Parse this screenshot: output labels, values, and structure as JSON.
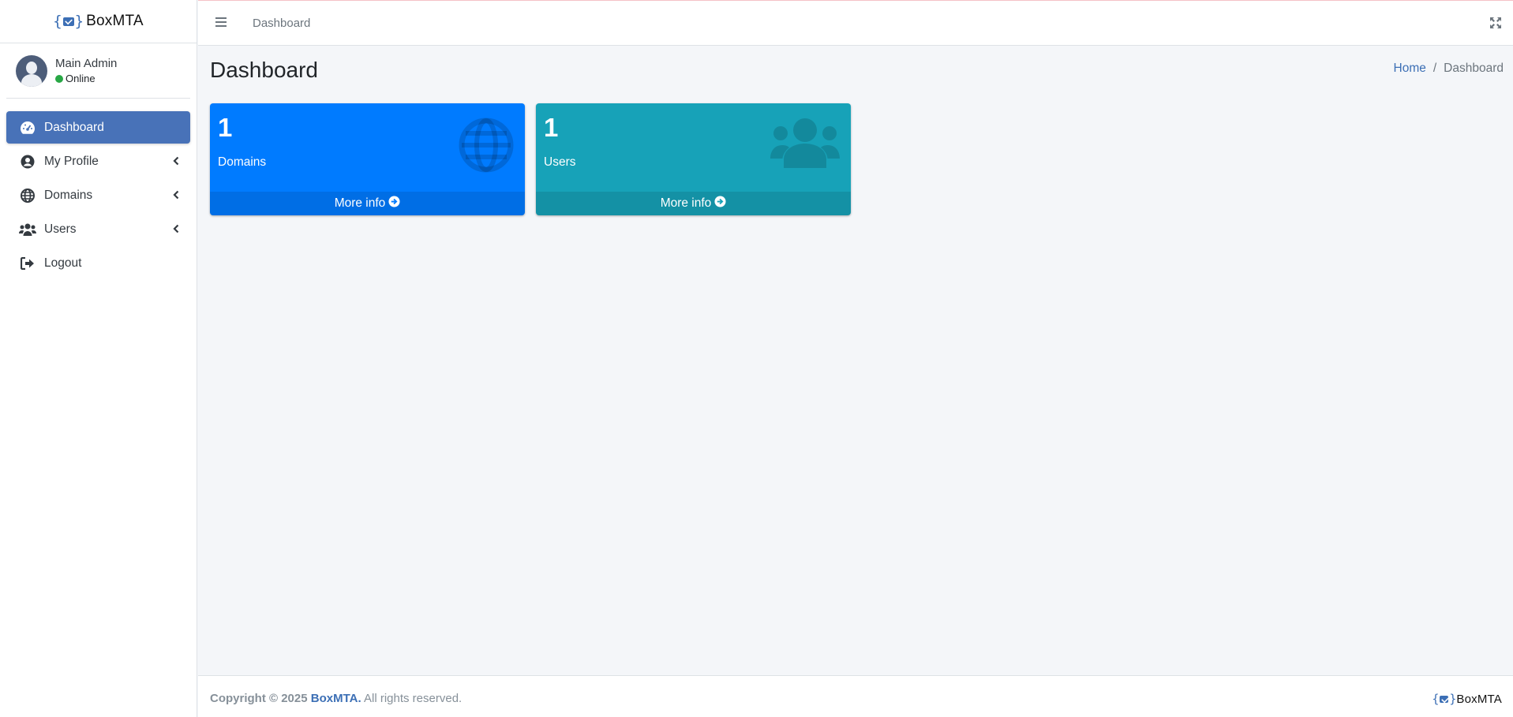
{
  "brand": {
    "name": "BoxMTA",
    "logo_icon": "envelope-braces-icon",
    "accent": "#3c6fb5"
  },
  "user": {
    "name": "Main Admin",
    "status": "Online",
    "status_color": "#28a745"
  },
  "sidebar": {
    "items": [
      {
        "label": "Dashboard",
        "icon": "tachometer-icon",
        "active": true
      },
      {
        "label": "My Profile",
        "icon": "user-circle-icon",
        "has_submenu": true
      },
      {
        "label": "Domains",
        "icon": "globe-icon",
        "has_submenu": true
      },
      {
        "label": "Users",
        "icon": "users-icon",
        "has_submenu": true
      },
      {
        "label": "Logout",
        "icon": "sign-out-icon"
      }
    ]
  },
  "topbar": {
    "link": "Dashboard"
  },
  "content": {
    "title": "Dashboard",
    "breadcrumb": {
      "home": "Home",
      "separator": "/",
      "current": "Dashboard"
    }
  },
  "boxes": [
    {
      "value": "1",
      "label": "Domains",
      "footer": "More info",
      "icon": "globe-icon",
      "color": "#007bff"
    },
    {
      "value": "1",
      "label": "Users",
      "footer": "More info",
      "icon": "users-icon",
      "color": "#17a2b8"
    }
  ],
  "footer": {
    "copyright": "Copyright © 2025",
    "brand": "BoxMTA.",
    "rights": "All rights reserved.",
    "logo_text": "BoxMTA"
  }
}
